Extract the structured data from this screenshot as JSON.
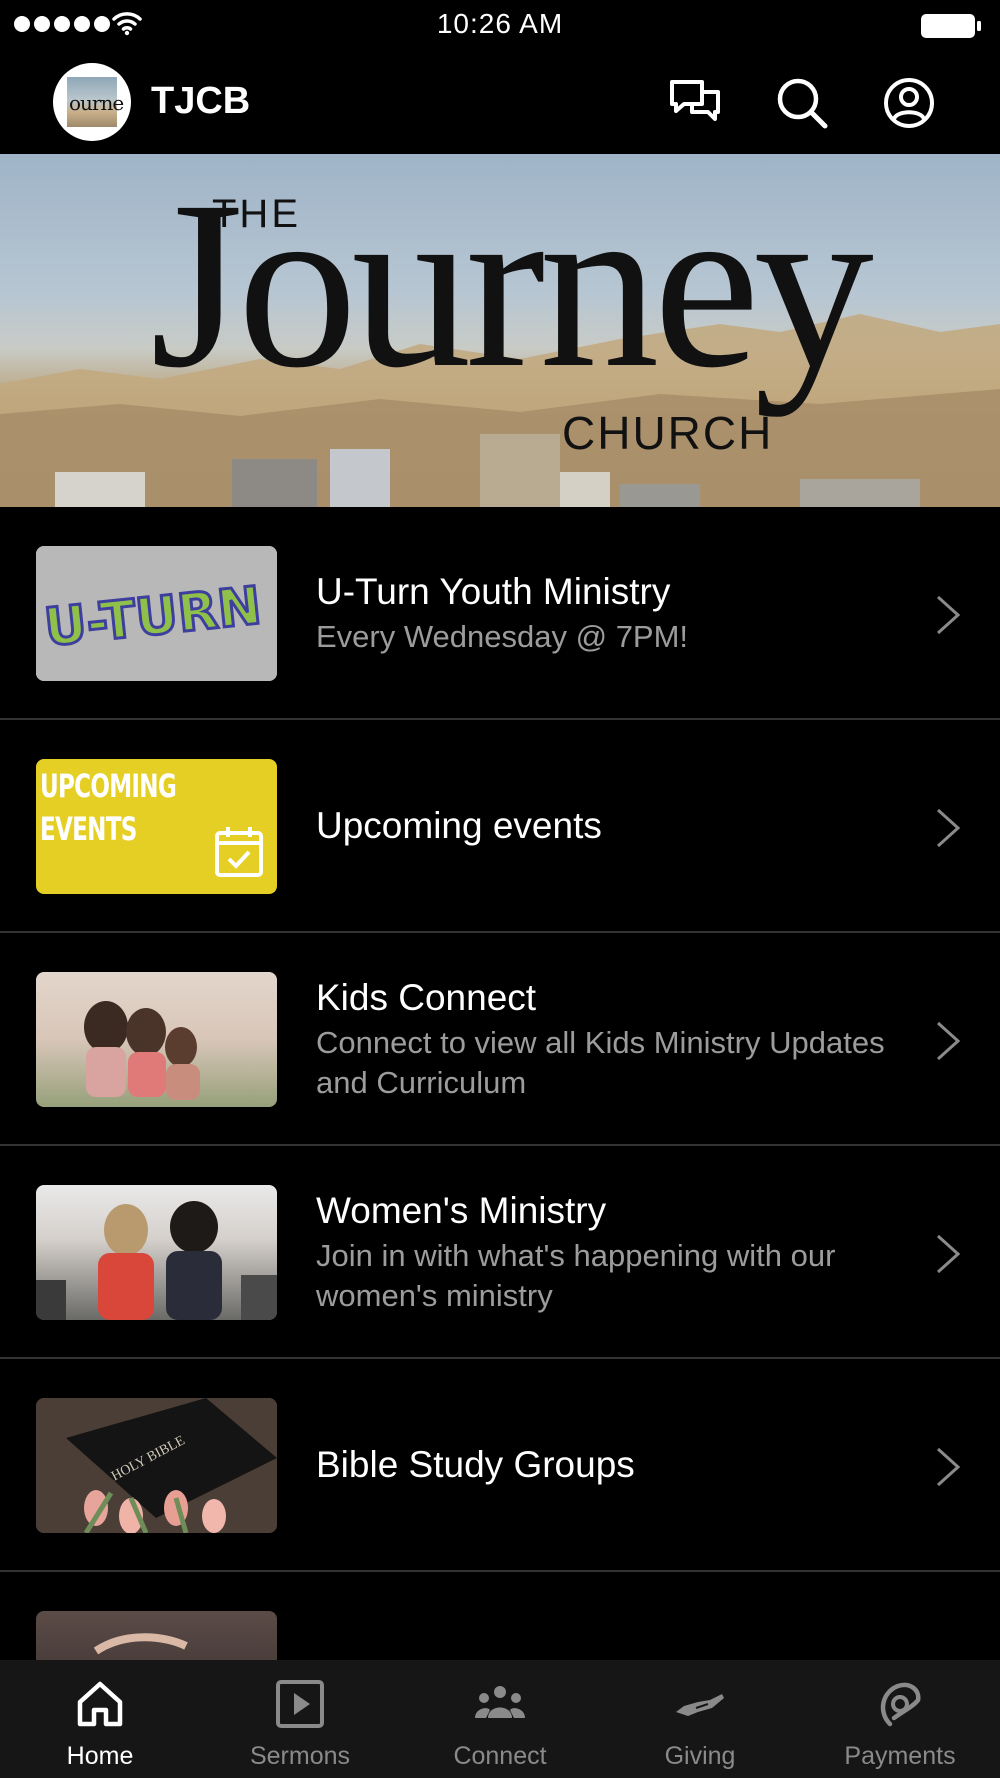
{
  "status_bar": {
    "time": "10:26 AM"
  },
  "header": {
    "app_title": "TJCB",
    "logo_text": "ourne"
  },
  "hero": {
    "the": "THE",
    "main": "Journey",
    "church": "CHURCH"
  },
  "list": {
    "items": [
      {
        "title": "U-Turn Youth Ministry",
        "subtitle": "Every Wednesday @ 7PM!",
        "thumb_text": "U-TURN"
      },
      {
        "title": "Upcoming events",
        "subtitle": "",
        "thumb_text": "UPCOMING EVENTS"
      },
      {
        "title": "Kids Connect",
        "subtitle": "Connect to view all Kids Ministry Updates and Curriculum"
      },
      {
        "title": "Women's Ministry",
        "subtitle": "Join in with what's happening with our women's ministry"
      },
      {
        "title": "Bible Study Groups",
        "subtitle": "",
        "thumb_text": "HOLY BIBLE"
      }
    ]
  },
  "tab_bar": {
    "tabs": [
      {
        "label": "Home",
        "icon": "home-icon",
        "active": true
      },
      {
        "label": "Sermons",
        "icon": "play-icon",
        "active": false
      },
      {
        "label": "Connect",
        "icon": "people-icon",
        "active": false
      },
      {
        "label": "Giving",
        "icon": "giving-hand-icon",
        "active": false
      },
      {
        "label": "Payments",
        "icon": "payments-icon",
        "active": false
      }
    ]
  },
  "colors": {
    "background": "#000000",
    "subtitle": "#9c9c9c",
    "divider": "#333333",
    "tab_bar": "#161616",
    "events_yellow": "#e6cf25"
  }
}
